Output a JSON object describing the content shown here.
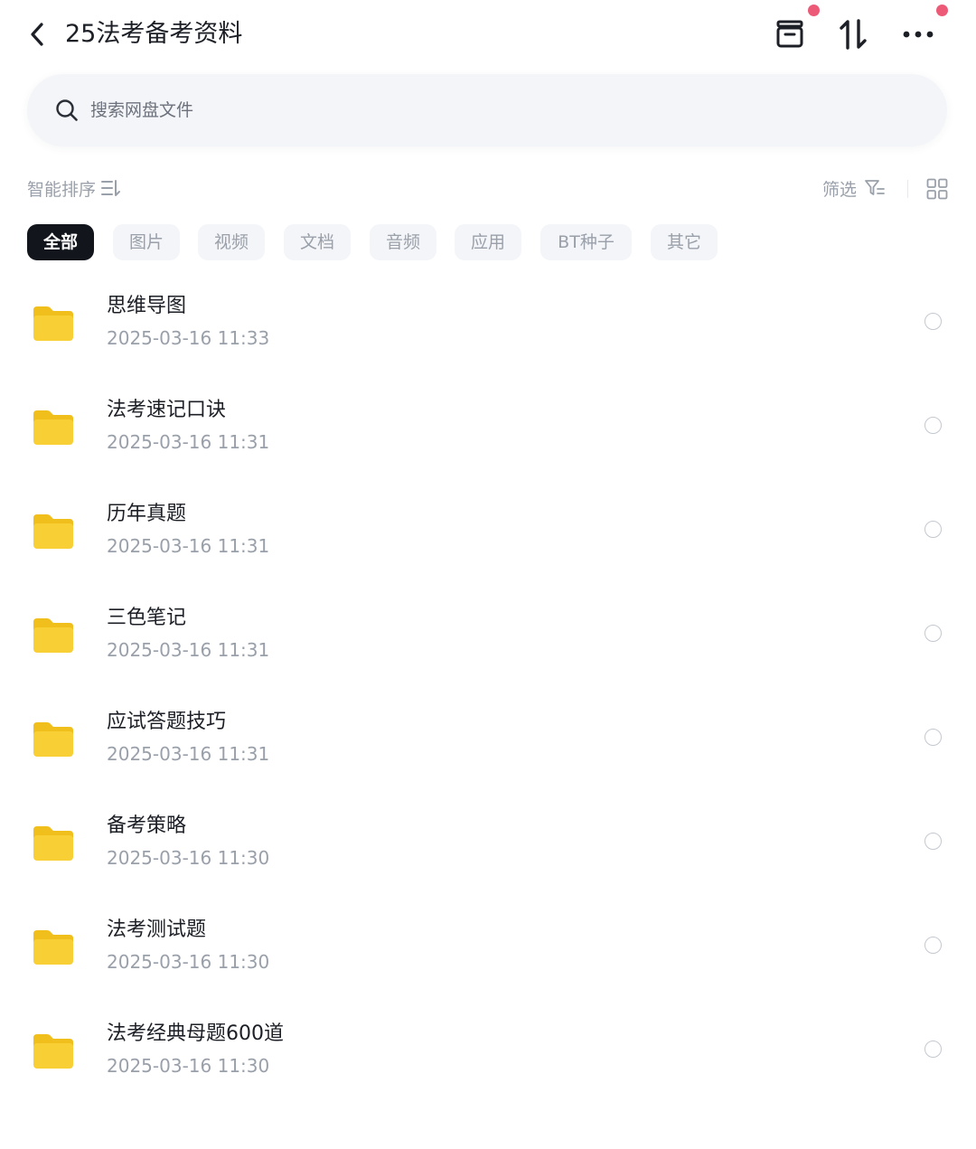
{
  "header": {
    "title": "25法考备考资料",
    "icons": {
      "back": "back-chevron-icon",
      "archive": "archive-icon",
      "transfer": "transfer-arrows-icon",
      "more": "more-dots-icon"
    },
    "notification_dot_color": "#ec5a78"
  },
  "search": {
    "placeholder": "搜索网盘文件",
    "value": "",
    "icon": "search-icon"
  },
  "toolbar": {
    "sort_label": "智能排序",
    "filter_label": "筛选",
    "view_toggle_icon": "grid-view-icon"
  },
  "categories": [
    {
      "label": "全部",
      "active": true
    },
    {
      "label": "图片",
      "active": false
    },
    {
      "label": "视频",
      "active": false
    },
    {
      "label": "文档",
      "active": false
    },
    {
      "label": "音频",
      "active": false
    },
    {
      "label": "应用",
      "active": false
    },
    {
      "label": "BT种子",
      "active": false
    },
    {
      "label": "其它",
      "active": false
    }
  ],
  "files": [
    {
      "name": "思维导图",
      "time": "2025-03-16  11:33",
      "type": "folder"
    },
    {
      "name": "法考速记口诀",
      "time": "2025-03-16  11:31",
      "type": "folder"
    },
    {
      "name": "历年真题",
      "time": "2025-03-16  11:31",
      "type": "folder"
    },
    {
      "name": "三色笔记",
      "time": "2025-03-16  11:31",
      "type": "folder"
    },
    {
      "name": "应试答题技巧",
      "time": "2025-03-16  11:31",
      "type": "folder"
    },
    {
      "name": "备考策略",
      "time": "2025-03-16  11:30",
      "type": "folder"
    },
    {
      "name": "法考测试题",
      "time": "2025-03-16  11:30",
      "type": "folder"
    },
    {
      "name": "法考经典母题600道",
      "time": "2025-03-16  11:30",
      "type": "folder"
    }
  ],
  "colors": {
    "folder": "#f9cf36",
    "folder_tab": "#f3c21f",
    "active_chip": "#12151c",
    "muted_text": "#9aa0aa"
  }
}
